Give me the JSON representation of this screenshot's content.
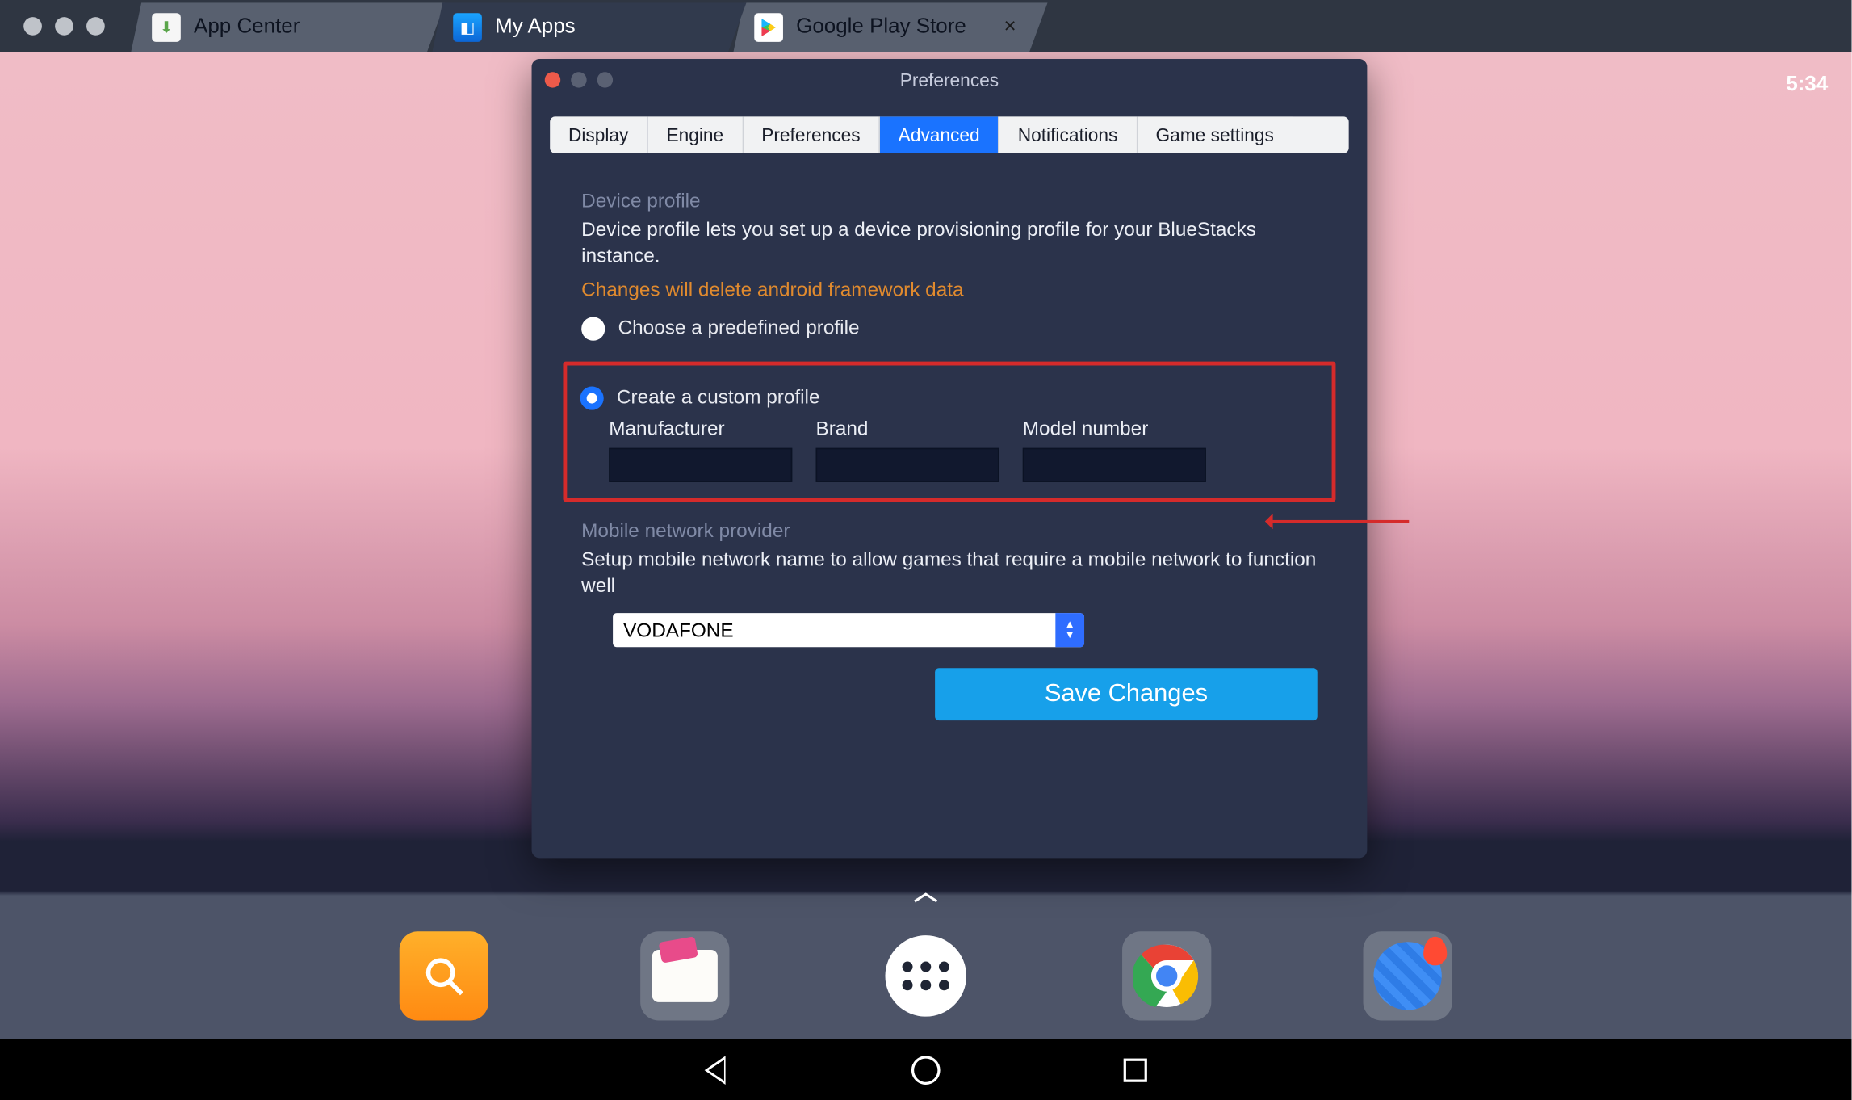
{
  "window": {
    "tabs": [
      {
        "label": "App Center",
        "icon": "appcenter"
      },
      {
        "label": "My Apps",
        "icon": "myapps"
      },
      {
        "label": "Google Play Store",
        "icon": "playstore",
        "closable": true
      }
    ],
    "active_tab_index": 1
  },
  "status": {
    "clock": "5:34"
  },
  "preferences": {
    "title": "Preferences",
    "tabs": [
      "Display",
      "Engine",
      "Preferences",
      "Advanced",
      "Notifications",
      "Game settings"
    ],
    "active_tab_index": 3,
    "device_profile": {
      "heading": "Device profile",
      "description": "Device profile lets you set up a device provisioning profile for your BlueStacks instance.",
      "warning": "Changes will delete android framework data",
      "option_predefined": "Choose a predefined profile",
      "option_custom": "Create a custom profile",
      "selected": "custom",
      "fields": {
        "manufacturer": {
          "label": "Manufacturer",
          "value": ""
        },
        "brand": {
          "label": "Brand",
          "value": ""
        },
        "model": {
          "label": "Model number",
          "value": ""
        }
      }
    },
    "network": {
      "heading": "Mobile network provider",
      "description": "Setup mobile network name to allow games that require a mobile network to function well",
      "selected": "VODAFONE"
    },
    "save_label": "Save Changes"
  },
  "dock": {
    "items": [
      "search",
      "files",
      "apps",
      "chrome",
      "maps"
    ]
  }
}
